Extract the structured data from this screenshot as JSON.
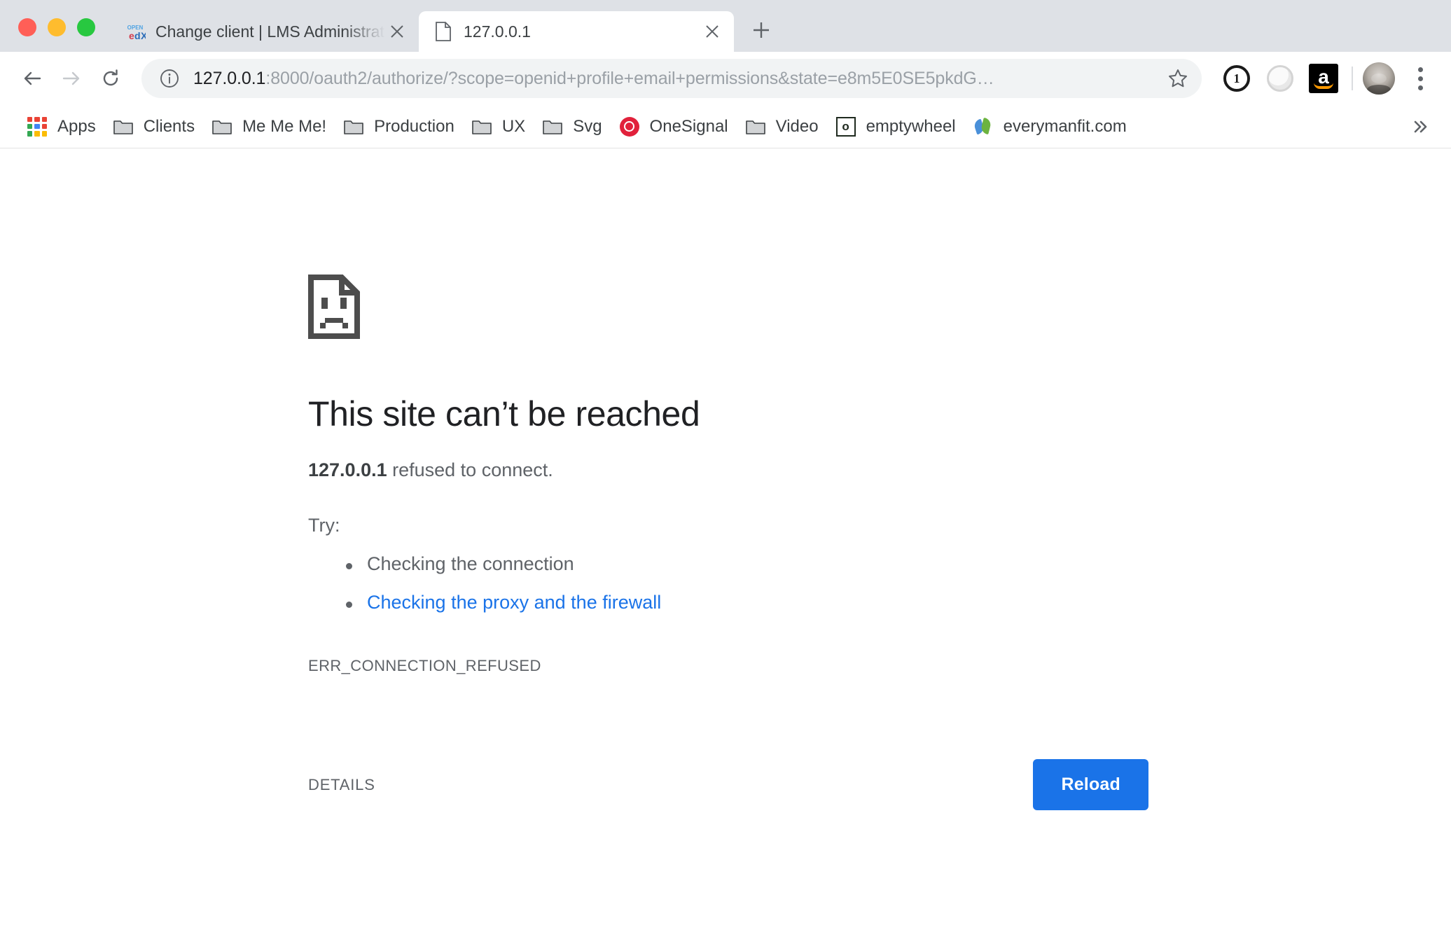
{
  "window": {
    "traffic_lights": [
      {
        "name": "close",
        "color": "#ff5f57"
      },
      {
        "name": "minimize",
        "color": "#febc2e"
      },
      {
        "name": "zoom",
        "color": "#28c840"
      }
    ]
  },
  "tabs": [
    {
      "title": "Change client | LMS Administration",
      "favicon": "openedx-favicon",
      "active": false
    },
    {
      "title": "127.0.0.1",
      "favicon": "blank-document-favicon",
      "active": true
    }
  ],
  "tabstrip": {
    "new_tab_label": "+",
    "close_label": "×"
  },
  "toolbar": {
    "back_label": "←",
    "forward_label": "→",
    "reload_label": "⟳",
    "url_host": "127.0.0.1",
    "url_rest": ":8000/oauth2/authorize/?scope=openid+profile+email+permissions&state=e8m5E0SE5pkdG…",
    "url_full": "127.0.0.1:8000/oauth2/authorize/?scope=openid+profile+email+permissions&state=e8m5E0SE5pkdG…",
    "extensions": [
      {
        "name": "1password-icon",
        "glyph": "1"
      },
      {
        "name": "extension-circle-icon",
        "glyph": ""
      },
      {
        "name": "amazon-icon",
        "glyph": "a"
      }
    ],
    "accent_color": "#1a73e8"
  },
  "bookmarks": {
    "overflow_label": "»",
    "items": [
      {
        "label": "Apps",
        "icon": "apps-grid-icon"
      },
      {
        "label": "Clients",
        "icon": "folder-icon"
      },
      {
        "label": "Me Me Me!",
        "icon": "folder-icon"
      },
      {
        "label": "Production",
        "icon": "folder-icon"
      },
      {
        "label": "UX",
        "icon": "folder-icon"
      },
      {
        "label": "Svg",
        "icon": "folder-icon"
      },
      {
        "label": "OneSignal",
        "icon": "onesignal-icon"
      },
      {
        "label": "Video",
        "icon": "folder-icon"
      },
      {
        "label": "emptywheel",
        "icon": "emptywheel-icon"
      },
      {
        "label": "everymanfit.com",
        "icon": "everymanfit-icon"
      }
    ]
  },
  "error_page": {
    "icon": "sad-page-icon",
    "title": "This site can’t be reached",
    "host": "127.0.0.1",
    "subtitle_rest": " refused to connect.",
    "try_label": "Try:",
    "suggestions": [
      {
        "text": "Checking the connection",
        "is_link": false
      },
      {
        "text": "Checking the proxy and the firewall",
        "is_link": true
      }
    ],
    "error_code": "ERR_CONNECTION_REFUSED",
    "details_label": "DETAILS",
    "reload_label": "Reload",
    "link_color": "#1a73e8"
  }
}
